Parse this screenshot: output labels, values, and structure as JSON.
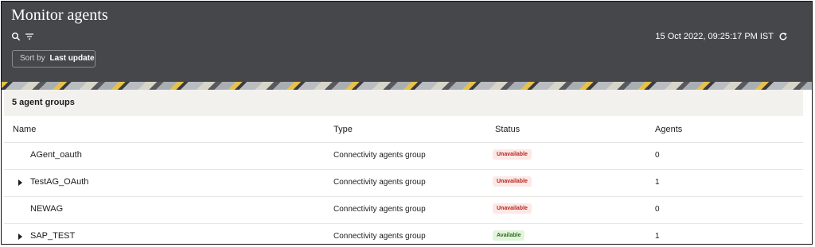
{
  "page": {
    "title": "Monitor agents",
    "timestamp": "15 Oct 2022, 09:25:17 PM IST",
    "sort_prefix": "Sort by",
    "sort_value": "Last update"
  },
  "icons": {
    "search": "search-icon",
    "filter": "filter-icon",
    "refresh": "refresh-icon",
    "expand": "caret-right-icon"
  },
  "colors": {
    "header_bg": "#46474b",
    "unavailable": "#b3261e",
    "available": "#2f6b1f"
  },
  "table": {
    "group_count_label": "5 agent groups",
    "columns": [
      "Name",
      "Type",
      "Status",
      "Agents"
    ],
    "rows": [
      {
        "name": "AGent_oauth",
        "type": "Connectivity agents group",
        "status": "Unavailable",
        "agents": "0",
        "expandable": false
      },
      {
        "name": "TestAG_OAuth",
        "type": "Connectivity agents group",
        "status": "Unavailable",
        "agents": "1",
        "expandable": true
      },
      {
        "name": "NEWAG",
        "type": "Connectivity agents group",
        "status": "Unavailable",
        "agents": "0",
        "expandable": false
      },
      {
        "name": "SAP_TEST",
        "type": "Connectivity agents group",
        "status": "Available",
        "agents": "1",
        "expandable": true
      }
    ]
  }
}
